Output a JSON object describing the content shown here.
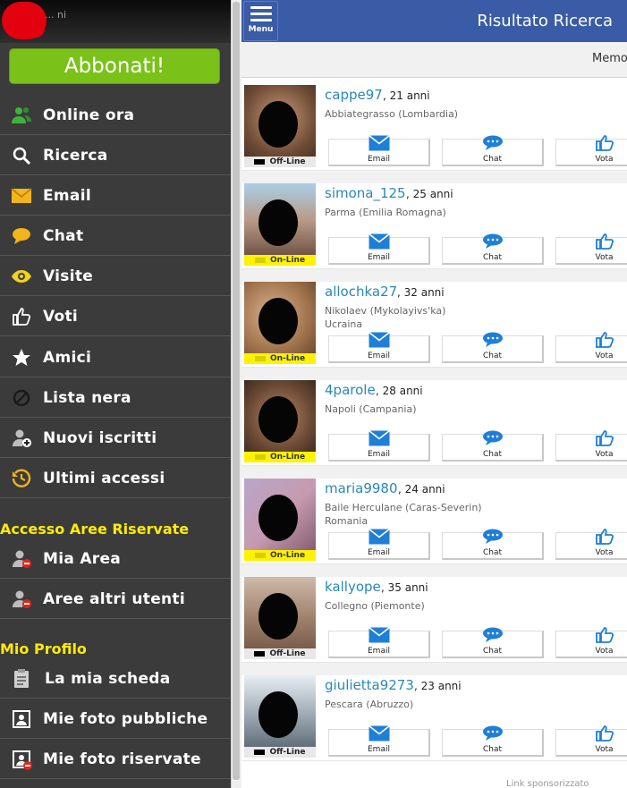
{
  "sidebar": {
    "username": "... ni",
    "subscribe_label": "Abbonati!",
    "items": [
      {
        "label": "Online ora",
        "icon": "users-online-icon"
      },
      {
        "label": "Ricerca",
        "icon": "search-icon"
      },
      {
        "label": "Email",
        "icon": "envelope-icon"
      },
      {
        "label": "Chat",
        "icon": "chat-bubble-icon"
      },
      {
        "label": "Visite",
        "icon": "eye-icon"
      },
      {
        "label": "Voti",
        "icon": "thumbs-up-icon"
      },
      {
        "label": "Amici",
        "icon": "star-icon"
      },
      {
        "label": "Lista nera",
        "icon": "blocked-icon"
      },
      {
        "label": "Nuovi iscritti",
        "icon": "user-add-icon"
      },
      {
        "label": "Ultimi accessi",
        "icon": "history-icon"
      }
    ],
    "section_reserved": "Accesso Aree Riservate",
    "reserved_items": [
      {
        "label": "Mia Area",
        "icon": "user-restricted-icon"
      },
      {
        "label": "Aree altri utenti",
        "icon": "users-restricted-icon"
      }
    ],
    "section_profile": "Mio Profilo",
    "profile_items": [
      {
        "label": "La mia scheda",
        "icon": "clipboard-icon"
      },
      {
        "label": "Mie foto pubbliche",
        "icon": "photo-portrait-icon"
      },
      {
        "label": "Mie foto riservate",
        "icon": "photo-locked-icon"
      }
    ]
  },
  "header": {
    "menu_label": "Menu",
    "title": "Risultato Ricerca",
    "memo_label": "Memo"
  },
  "actions": {
    "email": "Email",
    "chat": "Chat",
    "vote": "Vota"
  },
  "status_labels": {
    "offline": "Off-Line",
    "online": "On-Line"
  },
  "results": [
    {
      "name": "cappe97",
      "age": ", 21 anni",
      "location": "Abbiategrasso (Lombardia)",
      "location2": "",
      "status": "offline"
    },
    {
      "name": "simona_125",
      "age": ", 25 anni",
      "location": "Parma (Emilia Romagna)",
      "location2": "",
      "status": "online"
    },
    {
      "name": "allochka27",
      "age": ", 32 anni",
      "location": "Nikolaev (Mykolayivs'ka)",
      "location2": "Ucraina",
      "status": "online"
    },
    {
      "name": "4parole",
      "age": ", 28 anni",
      "location": "Napoli (Campania)",
      "location2": "",
      "status": "online"
    },
    {
      "name": "maria9980",
      "age": ", 24 anni",
      "location": "Baile Herculane (Caras-Severin)",
      "location2": "Romania",
      "status": "online"
    },
    {
      "name": "kallyope",
      "age": ", 35 anni",
      "location": "Collegno (Piemonte)",
      "location2": "",
      "status": "offline"
    },
    {
      "name": "giulietta9273",
      "age": ", 23 anni",
      "location": "Pescara (Abruzzo)",
      "location2": "",
      "status": "offline"
    }
  ],
  "footer": {
    "sponsored": "Link sponsorizzato"
  },
  "colors": {
    "sidebar_bg": "#3b3b3b",
    "accent_green": "#7ac11a",
    "section_yellow": "#ffec00",
    "header_blue": "#3a5ba5",
    "username_blue": "#2a88b7",
    "online_yellow": "#fff200"
  }
}
